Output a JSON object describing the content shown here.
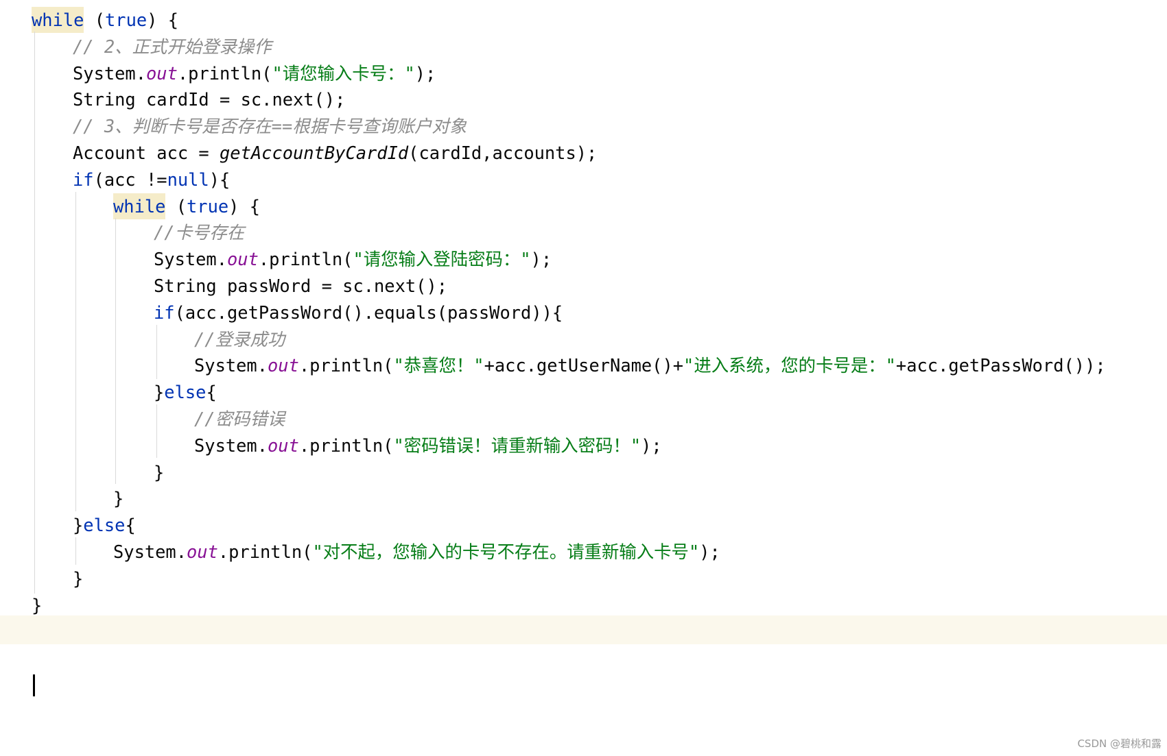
{
  "editor": {
    "lines": [
      [
        {
          "t": "kw-hl",
          "v": "while"
        },
        {
          "t": "plain",
          "v": " ("
        },
        {
          "t": "kw",
          "v": "true"
        },
        {
          "t": "plain",
          "v": ") {"
        }
      ],
      [
        {
          "t": "cmt",
          "v": "// 2、正式开始登录操作"
        }
      ],
      [
        {
          "t": "plain",
          "v": "System."
        },
        {
          "t": "field",
          "v": "out"
        },
        {
          "t": "plain",
          "v": ".println("
        },
        {
          "t": "str",
          "v": "\"请您输入卡号：\""
        },
        {
          "t": "plain",
          "v": ");"
        }
      ],
      [
        {
          "t": "plain",
          "v": "String cardId = sc.next();"
        }
      ],
      [
        {
          "t": "cmt",
          "v": "// 3、判断卡号是否存在==根据卡号查询账户对象"
        }
      ],
      [
        {
          "t": "plain",
          "v": "Account acc = "
        },
        {
          "t": "static",
          "v": "getAccountByCardId"
        },
        {
          "t": "plain",
          "v": "(cardId,accounts);"
        }
      ],
      [
        {
          "t": "kw",
          "v": "if"
        },
        {
          "t": "plain",
          "v": "(acc !="
        },
        {
          "t": "kw",
          "v": "null"
        },
        {
          "t": "plain",
          "v": "){"
        }
      ],
      [
        {
          "t": "kw-hl",
          "v": "while"
        },
        {
          "t": "plain",
          "v": " ("
        },
        {
          "t": "kw",
          "v": "true"
        },
        {
          "t": "plain",
          "v": ") {"
        }
      ],
      [
        {
          "t": "cmt",
          "v": "//卡号存在"
        }
      ],
      [
        {
          "t": "plain",
          "v": "System."
        },
        {
          "t": "field",
          "v": "out"
        },
        {
          "t": "plain",
          "v": ".println("
        },
        {
          "t": "str",
          "v": "\"请您输入登陆密码：\""
        },
        {
          "t": "plain",
          "v": ");"
        }
      ],
      [
        {
          "t": "plain",
          "v": "String passWord = sc.next();"
        }
      ],
      [
        {
          "t": "kw",
          "v": "if"
        },
        {
          "t": "plain",
          "v": "(acc.getPassWord().equals(passWord)){"
        }
      ],
      [
        {
          "t": "cmt",
          "v": "//登录成功"
        }
      ],
      [
        {
          "t": "plain",
          "v": "System."
        },
        {
          "t": "field",
          "v": "out"
        },
        {
          "t": "plain",
          "v": ".println("
        },
        {
          "t": "str",
          "v": "\"恭喜您！\""
        },
        {
          "t": "plain",
          "v": "+acc.getUserName()+"
        },
        {
          "t": "str",
          "v": "\"进入系统，您的卡号是：\""
        },
        {
          "t": "plain",
          "v": "+acc.getPassWord());"
        }
      ],
      [
        {
          "t": "plain",
          "v": "}"
        },
        {
          "t": "kw",
          "v": "else"
        },
        {
          "t": "plain",
          "v": "{"
        }
      ],
      [
        {
          "t": "cmt",
          "v": "//密码错误"
        }
      ],
      [
        {
          "t": "plain",
          "v": "System."
        },
        {
          "t": "field",
          "v": "out"
        },
        {
          "t": "plain",
          "v": ".println("
        },
        {
          "t": "str",
          "v": "\"密码错误！请重新输入密码！\""
        },
        {
          "t": "plain",
          "v": ");"
        }
      ],
      [
        {
          "t": "plain",
          "v": "}"
        }
      ],
      [
        {
          "t": "plain",
          "v": "}"
        }
      ],
      [
        {
          "t": "plain",
          "v": "}"
        },
        {
          "t": "kw",
          "v": "else"
        },
        {
          "t": "plain",
          "v": "{"
        }
      ],
      [
        {
          "t": "plain",
          "v": "System."
        },
        {
          "t": "field",
          "v": "out"
        },
        {
          "t": "plain",
          "v": ".println("
        },
        {
          "t": "str",
          "v": "\"对不起，您输入的卡号不存在。请重新输入卡号\""
        },
        {
          "t": "plain",
          "v": ");"
        }
      ],
      [
        {
          "t": "plain",
          "v": "}"
        }
      ],
      [
        {
          "t": "plain",
          "v": "}"
        }
      ],
      []
    ]
  },
  "top_brace": "}",
  "watermark": "CSDN @碧桃和露",
  "colors": {
    "keyword": "#0033b3",
    "keyword_highlight_bg": "#f5ecc9",
    "field": "#871094",
    "string": "#067d17",
    "comment": "#8c8c8c",
    "text": "#080808",
    "current_line_bg": "#fbf8ec",
    "indent_guide": "#d9d9d9"
  }
}
